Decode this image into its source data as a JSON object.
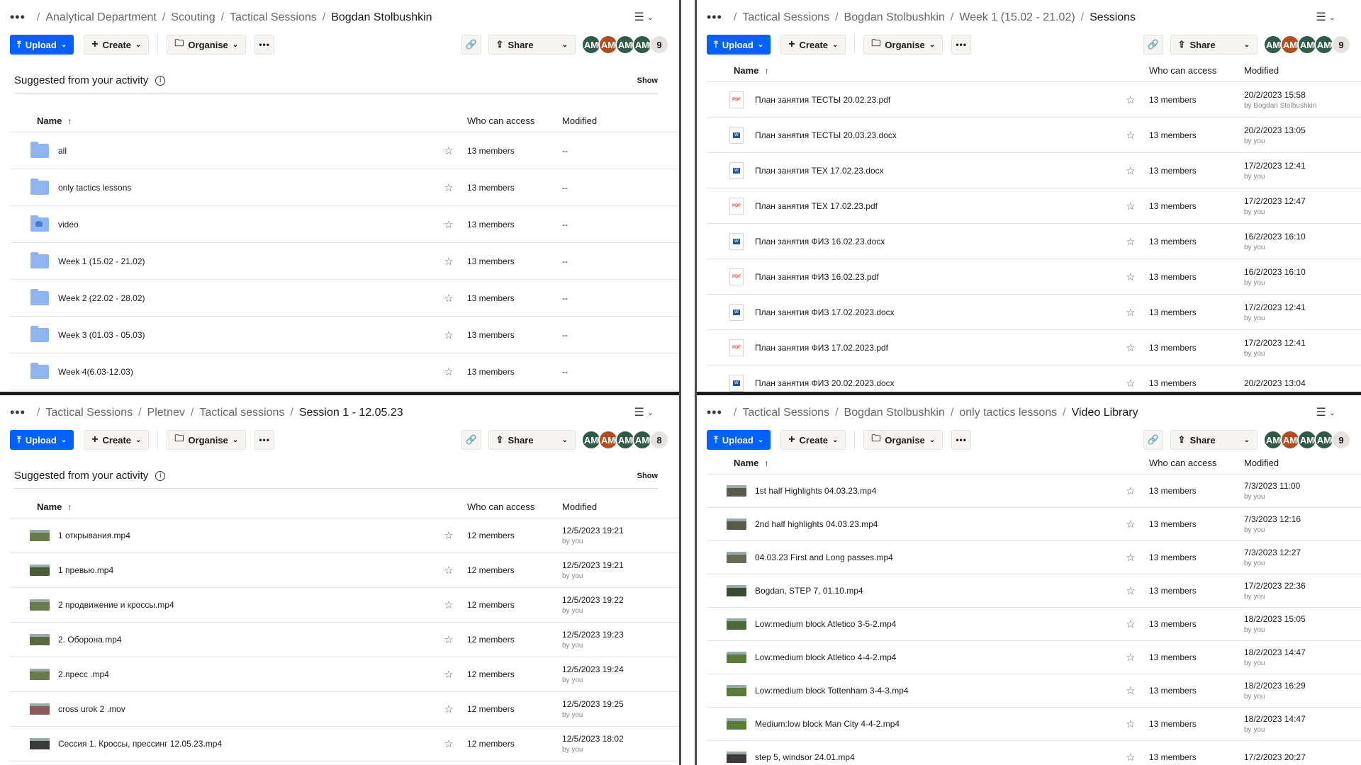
{
  "common": {
    "upload": "Upload",
    "create": "Create",
    "organise": "Organise",
    "share": "Share",
    "col_name": "Name",
    "col_access": "Who can access",
    "col_modified": "Modified",
    "suggested": "Suggested from your activity",
    "show": "Show",
    "avatar_initials": "AM",
    "star": "☆",
    "sort_arrow": "↑",
    "colors": {
      "primary": "#0061fe",
      "avatar_green": "#2f5b48",
      "avatar_orange": "#b34d20"
    }
  },
  "panes": [
    {
      "breadcrumb": [
        "Analytical Department",
        "Scouting",
        "Tactical Sessions"
      ],
      "current": "Bogdan Stolbushkin",
      "member_count": "9",
      "has_suggested": true,
      "rows": [
        {
          "name": "all",
          "icon": "folder",
          "access": "13 members",
          "date": "--",
          "by": ""
        },
        {
          "name": "only tactics lessons",
          "icon": "folder",
          "access": "13 members",
          "date": "--",
          "by": ""
        },
        {
          "name": "video",
          "icon": "folder-shared",
          "access": "13 members",
          "date": "--",
          "by": ""
        },
        {
          "name": "Week 1 (15.02 - 21.02)",
          "icon": "folder",
          "access": "13 members",
          "date": "--",
          "by": ""
        },
        {
          "name": "Week 2 (22.02 - 28.02)",
          "icon": "folder",
          "access": "13 members",
          "date": "--",
          "by": ""
        },
        {
          "name": "Week 3 (01.03 - 05.03)",
          "icon": "folder",
          "access": "13 members",
          "date": "--",
          "by": ""
        },
        {
          "name": "Week 4(6.03-12.03)",
          "icon": "folder",
          "access": "13 members",
          "date": "--",
          "by": ""
        }
      ]
    },
    {
      "breadcrumb": [
        "Tactical Sessions",
        "Bogdan Stolbushkin",
        "Week 1 (15.02 - 21.02)"
      ],
      "current": "Sessions",
      "member_count": "9",
      "has_suggested": false,
      "rows": [
        {
          "name": "План занятия ТЕСТЫ 20.02.23.pdf",
          "icon": "pdf",
          "access": "13 members",
          "date": "20/2/2023 15:58",
          "by": "by Bogdan Stolbushkin"
        },
        {
          "name": "План занятия ТЕСТЫ 20.03.23.docx",
          "icon": "docx",
          "access": "13 members",
          "date": "20/2/2023 13:05",
          "by": "by you"
        },
        {
          "name": "План занятия ТЕХ 17.02.23.docx",
          "icon": "docx",
          "access": "13 members",
          "date": "17/2/2023 12:41",
          "by": "by you"
        },
        {
          "name": "План занятия ТЕХ 17.02.23.pdf",
          "icon": "pdf",
          "access": "13 members",
          "date": "17/2/2023 12:47",
          "by": "by you"
        },
        {
          "name": "План занятия ФИЗ 16.02.23.docx",
          "icon": "docx",
          "access": "13 members",
          "date": "16/2/2023 16:10",
          "by": "by you"
        },
        {
          "name": "План занятия ФИЗ 16.02.23.pdf",
          "icon": "pdf",
          "access": "13 members",
          "date": "16/2/2023 16:10",
          "by": "by you"
        },
        {
          "name": "План занятия ФИЗ 17.02.2023.docx",
          "icon": "docx",
          "access": "13 members",
          "date": "17/2/2023 12:41",
          "by": "by you"
        },
        {
          "name": "План занятия ФИЗ 17.02.2023.pdf",
          "icon": "pdf",
          "access": "13 members",
          "date": "17/2/2023 12:41",
          "by": "by you"
        },
        {
          "name": "План занятия ФИЗ 20.02.2023.docx",
          "icon": "docx",
          "access": "13 members",
          "date": "20/2/2023 13:04",
          "by": ""
        }
      ]
    },
    {
      "breadcrumb": [
        "Tactical Sessions",
        "Pletnev",
        "Tactical sessions"
      ],
      "current": "Session 1 - 12.05.23",
      "member_count": "8",
      "has_suggested": true,
      "rows": [
        {
          "name": "1 открывания.mp4",
          "icon": "video",
          "thumb": "#6b7a4a",
          "access": "12 members",
          "date": "12/5/2023 19:21",
          "by": "by you"
        },
        {
          "name": "1 превью.mp4",
          "icon": "video",
          "thumb": "#4a5a3a",
          "access": "12 members",
          "date": "12/5/2023 19:21",
          "by": "by you"
        },
        {
          "name": "2 продвижение и кроссы.mp4",
          "icon": "video",
          "thumb": "#6b7a4a",
          "access": "12 members",
          "date": "12/5/2023 19:22",
          "by": "by you"
        },
        {
          "name": "2. Оборона.mp4",
          "icon": "video",
          "thumb": "#5a6a40",
          "access": "12 members",
          "date": "12/5/2023 19:23",
          "by": "by you"
        },
        {
          "name": "2.пресс .mp4",
          "icon": "video",
          "thumb": "#6b7a4a",
          "access": "12 members",
          "date": "12/5/2023 19:24",
          "by": "by you"
        },
        {
          "name": "cross urok 2 .mov",
          "icon": "video",
          "thumb": "#8a5a5a",
          "access": "12 members",
          "date": "12/5/2023 19:25",
          "by": "by you"
        },
        {
          "name": "Сессия 1. Кроссы, прессинг 12.05.23.mp4",
          "icon": "video",
          "thumb": "#3a3a3a",
          "access": "12 members",
          "date": "12/5/2023 18:02",
          "by": "by you"
        }
      ]
    },
    {
      "breadcrumb": [
        "Tactical Sessions",
        "Bogdan Stolbushkin",
        "only tactics lessons"
      ],
      "current": "Video Library",
      "member_count": "9",
      "has_suggested": false,
      "rows": [
        {
          "name": "1st half Highlights 04.03.23.mp4",
          "icon": "video",
          "thumb": "#5a5a4a",
          "access": "13 members",
          "date": "7/3/2023 11:00",
          "by": "by you"
        },
        {
          "name": "2nd half highlights 04.03.23.mp4",
          "icon": "video",
          "thumb": "#5a5a4a",
          "access": "13 members",
          "date": "7/3/2023 12:16",
          "by": "by you"
        },
        {
          "name": "04.03.23 First and Long passes.mp4",
          "icon": "video",
          "thumb": "#6a6a5a",
          "access": "13 members",
          "date": "7/3/2023 12:27",
          "by": "by you"
        },
        {
          "name": "Bogdan, STEP 7, 01.10.mp4",
          "icon": "video",
          "thumb": "#3a4a30",
          "access": "13 members",
          "date": "17/2/2023 22:36",
          "by": "by you"
        },
        {
          "name": "Low:medium block Atletico 3-5-2.mp4",
          "icon": "video",
          "thumb": "#4a6a3a",
          "access": "13 members",
          "date": "18/2/2023 15:05",
          "by": "by you"
        },
        {
          "name": "Low:medium block Atletico 4-4-2.mp4",
          "icon": "video",
          "thumb": "#5a7a3a",
          "access": "13 members",
          "date": "18/2/2023 14:47",
          "by": "by you"
        },
        {
          "name": "Low:medium block Tottenham 3-4-3.mp4",
          "icon": "video",
          "thumb": "#5a7a3a",
          "access": "13 members",
          "date": "18/2/2023 16:29",
          "by": "by you"
        },
        {
          "name": "Medium:low block Man City 4-4-2.mp4",
          "icon": "video",
          "thumb": "#5a7a3a",
          "access": "13 members",
          "date": "18/2/2023 14:47",
          "by": "by you"
        },
        {
          "name": "step 5, windsor 24.01.mp4",
          "icon": "video",
          "thumb": "#3a3a3a",
          "access": "13 members",
          "date": "17/2/2023 20:27",
          "by": ""
        }
      ]
    }
  ]
}
